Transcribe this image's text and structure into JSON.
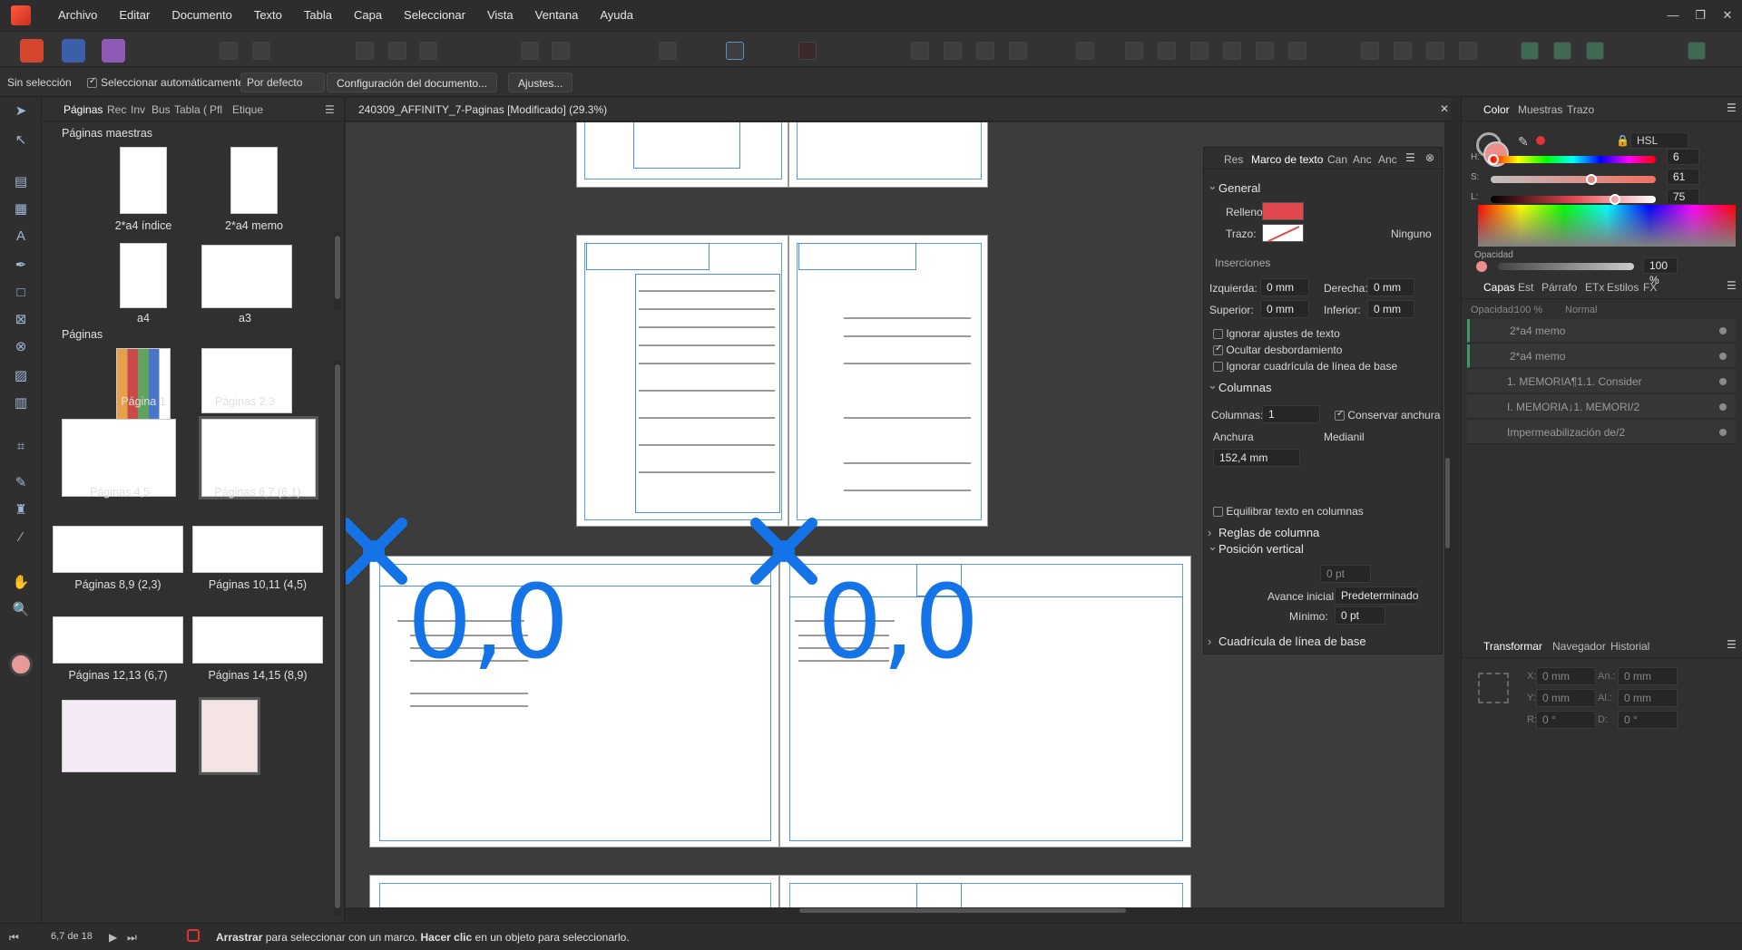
{
  "menu": {
    "items": [
      "Archivo",
      "Editar",
      "Documento",
      "Texto",
      "Tabla",
      "Capa",
      "Seleccionar",
      "Vista",
      "Ventana",
      "Ayuda"
    ]
  },
  "context": {
    "selection": "Sin selección",
    "auto_select_label": "Seleccionar automáticamente:",
    "auto_select_value": "Por defecto",
    "doc_setup_button": "Configuración del documento...",
    "settings_button": "Ajustes..."
  },
  "left_panel": {
    "tabs": [
      "Páginas",
      "Rec",
      "Inv",
      "Bus",
      "Tabla (",
      "Pfl",
      "Etique"
    ],
    "masters_title": "Páginas maestras",
    "masters": [
      "2*a4 índice",
      "2*a4 memo",
      "a4",
      "a3"
    ],
    "pages_title": "Páginas",
    "pages": [
      "Página 1",
      "Páginas 2,3",
      "Páginas 4,5",
      "Páginas 6,7 (6,1)",
      "Páginas 8,9 (2,3)",
      "Páginas 10,11 (4,5)",
      "Páginas 12,13 (6,7)",
      "Páginas 14,15 (8,9)"
    ]
  },
  "document": {
    "tab_title": "240309_AFFINITY_7-Paginas [Modificado] (29.3%)",
    "overlay_left": "0,0",
    "overlay_right": "0,0"
  },
  "text_frame_panel": {
    "tabs": [
      "Res",
      "Marco de texto",
      "Can",
      "Anc",
      "Anc"
    ],
    "general": "General",
    "fill_label": "Relleno:",
    "fill_color": "#e0484e",
    "stroke_label": "Trazo:",
    "stroke_value": "Ninguno",
    "insets_title": "Inserciones",
    "left_label": "Izquierda:",
    "left_value": "0 mm",
    "right_label": "Derecha:",
    "right_value": "0 mm",
    "top_label": "Superior:",
    "top_value": "0 mm",
    "bottom_label": "Inferior:",
    "bottom_value": "0 mm",
    "ignore_text_wrap": "Ignorar ajustes de texto",
    "hide_overflow": "Ocultar desbordamiento",
    "ignore_baseline": "Ignorar cuadrícula de línea de base",
    "columns_title": "Columnas",
    "columns_label": "Columnas:",
    "columns_value": "1",
    "keep_width": "Conservar anchura",
    "width_label": "Anchura",
    "gutter_label": "Medianil",
    "width_value": "152,4 mm",
    "balance_columns": "Equilibrar texto en columnas",
    "column_rules": "Reglas de columna",
    "vertical_position": "Posición vertical",
    "vert_value": "0 pt",
    "first_advance_label": "Avance inicial:",
    "first_advance_value": "Predeterminado",
    "minimum_label": "Mínimo:",
    "minimum_value": "0 pt",
    "baseline_grid": "Cuadrícula de línea de base"
  },
  "color_panel": {
    "tabs": [
      "Color",
      "Muestras",
      "Trazo"
    ],
    "model": "HSL",
    "h_label": "H:",
    "h_value": "6",
    "s_label": "S:",
    "s_value": "61",
    "l_label": "L:",
    "l_value": "75",
    "opacity_label": "Opacidad",
    "opacity_value": "100 %",
    "h_fraction": 0.017,
    "s_fraction": 0.61,
    "l_fraction": 0.75
  },
  "layers_panel": {
    "tabs": [
      "Capas",
      "Est",
      "Párrafo",
      "ETx",
      "Estilos",
      "FX"
    ],
    "opacity_label": "Opacidad:",
    "opacity_value": "100 %",
    "blend_value": "Normal",
    "layers": [
      "2*a4 memo",
      "2*a4 memo",
      "1. MEMORIA¶1.1. Consider",
      "I. MEMORIA↓1. MEMORI/2",
      "Impermeabilización de/2"
    ]
  },
  "transform_panel": {
    "tabs": [
      "Transformar",
      "Navegador",
      "Historial"
    ],
    "x_label": "X:",
    "x_value": "0 mm",
    "y_label": "Y:",
    "y_value": "0 mm",
    "w_label": "An.:",
    "w_value": "0 mm",
    "h_label": "Al.:",
    "h_value": "0 mm",
    "r_label": "R:",
    "r_value": "0 °",
    "s_label": "D:",
    "s_value": "0 °"
  },
  "status": {
    "page_indicator": "6,7 de 18",
    "drag_bold": "Arrastrar",
    "drag_text": "para seleccionar con un marco.",
    "click_bold": "Hacer clic",
    "click_text": "en un objeto para seleccionarlo."
  }
}
